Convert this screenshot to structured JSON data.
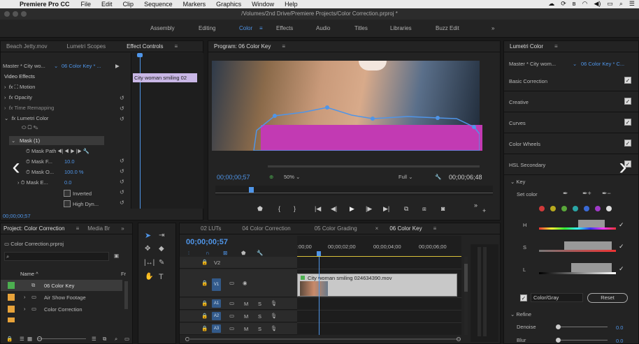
{
  "menubar": {
    "apple": "",
    "app": "Premiere Pro CC",
    "items": [
      "File",
      "Edit",
      "Clip",
      "Sequence",
      "Markers",
      "Graphics",
      "Window",
      "Help"
    ]
  },
  "titlebar": {
    "path": "/Volumes/2nd Drive/Premiere Projects/Color Correction.prproj *"
  },
  "workspaces": {
    "items": [
      "Assembly",
      "Editing",
      "Color",
      "Effects",
      "Audio",
      "Titles",
      "Libraries",
      "Buzz Edit"
    ],
    "active": "Color",
    "more": "»"
  },
  "source_panel": {
    "tabs": [
      "Beach Jetty.mov",
      "Lumetri Scopes",
      "Effect Controls"
    ],
    "active_tab": "Effect Controls",
    "master": "Master * City wo...",
    "sequence": "06 Color Key * ...",
    "clip_label": "City woman smiling 02",
    "section": "Video Effects",
    "effects": [
      "Motion",
      "Opacity",
      "Time Remapping",
      "Lumetri Color"
    ],
    "mask": "Mask (1)",
    "mask_path": "Mask Path",
    "mask_feather": {
      "label": "Mask F...",
      "value": "10.0"
    },
    "mask_opacity": {
      "label": "Mask O...",
      "value": "100.0 %"
    },
    "mask_expansion": {
      "label": "Mask E...",
      "value": "0.0"
    },
    "inverted": "Inverted",
    "high_dyn": "High Dyn...",
    "timecode": "00;00;00;57"
  },
  "program": {
    "title": "Program: 06 Color Key",
    "timecode": "00;00;00;57",
    "zoom": "50%",
    "quality": "Full",
    "duration": "00;00;06;48"
  },
  "lumetri": {
    "title": "Lumetri Color",
    "master": "Master * City wom...",
    "sequence": "06 Color Key * C...",
    "sections": [
      "Basic Correction",
      "Creative",
      "Curves",
      "Color Wheels",
      "HSL Secondary"
    ],
    "key": "Key",
    "set_color": "Set color",
    "swatch_colors": [
      "#d03a3a",
      "#b8a91e",
      "#5aa83a",
      "#2aa6a6",
      "#3a6ad6",
      "#a03ac8",
      "#dddddd"
    ],
    "sliders": [
      "H",
      "S",
      "L"
    ],
    "color_gray": "Color/Gray",
    "reset": "Reset",
    "refine": "Refine",
    "denoise": {
      "label": "Denoise",
      "value": "0.0"
    },
    "blur": {
      "label": "Blur",
      "value": "0.0"
    }
  },
  "project": {
    "tabs": [
      "Project: Color Correction",
      "Media Br"
    ],
    "file": "Color Correction.prproj",
    "col_name": "Name",
    "col_fr": "Fr",
    "items": [
      {
        "name": "06 Color Key",
        "color": "#4caf50"
      },
      {
        "name": "Air Show Footage",
        "color": "#e8a33a"
      },
      {
        "name": "Color Correction",
        "color": "#e8a33a"
      }
    ]
  },
  "timeline": {
    "tabs": [
      "02 LUTs",
      "04 Color Correction",
      "05 Color Grading",
      "06 Color Key"
    ],
    "active_tab": "06 Color Key",
    "timecode": "00;00;00;57",
    "ruler": [
      ":00;00",
      "00;00;02;00",
      "00;00;04;00",
      "00;00;06;00"
    ],
    "tracks": [
      "V2",
      "V1",
      "A1",
      "A2",
      "A3"
    ],
    "track_buttons": [
      "M",
      "S"
    ],
    "clip_name": "City woman smiling 024634390.mov"
  }
}
